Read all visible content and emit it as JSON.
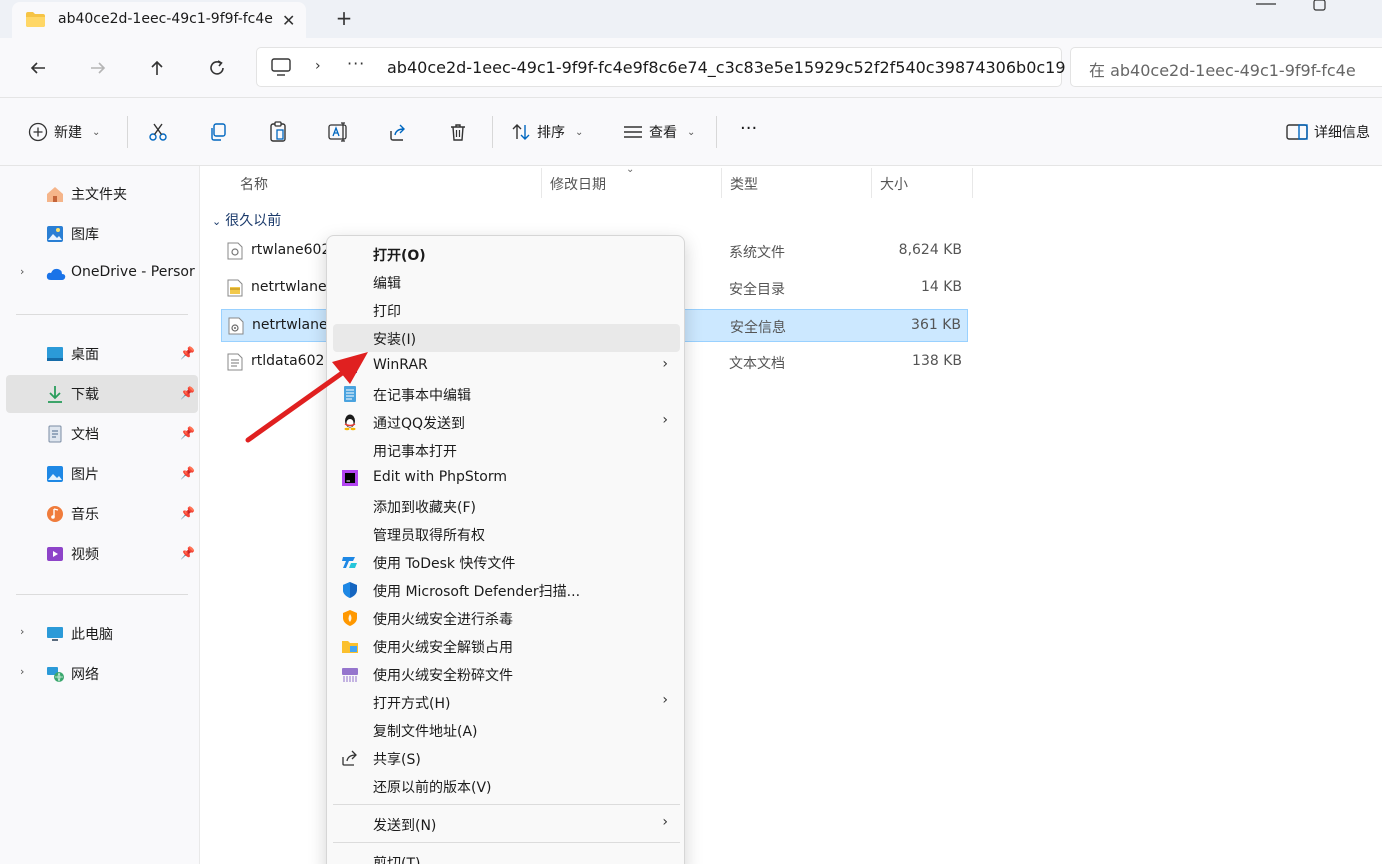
{
  "tab": {
    "title": "ab40ce2d-1eec-49c1-9f9f-fc4e",
    "close": "✕",
    "new_tab": "+"
  },
  "address": {
    "separator": "›",
    "more": "···",
    "path": "ab40ce2d-1eec-49c1-9f9f-fc4e9f8c6e74_c3c83e5e15929c52f2f540c39874306b0c19",
    "search_placeholder": "在 ab40ce2d-1eec-49c1-9f9f-fc4e"
  },
  "toolbar": {
    "new_label": "新建",
    "sort_label": "排序",
    "view_label": "查看",
    "more": "···",
    "details_label": "详细信息"
  },
  "sidebar": {
    "home": "主文件夹",
    "gallery": "图库",
    "onedrive": "OneDrive - Persor",
    "desktop": "桌面",
    "downloads": "下载",
    "documents": "文档",
    "pictures": "图片",
    "music": "音乐",
    "videos": "视频",
    "this_pc": "此电脑",
    "network": "网络"
  },
  "columns": {
    "name": "名称",
    "modified": "修改日期",
    "type": "类型",
    "size": "大小"
  },
  "group_label": "很久以前",
  "files": [
    {
      "name": "rtwlane602",
      "type": "系统文件",
      "size": "8,624 KB"
    },
    {
      "name": "netrtwlane",
      "type": "安全目录",
      "size": "14 KB"
    },
    {
      "name": "netrtwlane",
      "type": "安全信息",
      "size": "361 KB"
    },
    {
      "name": "rtldata602",
      "type": "文本文档",
      "size": "138 KB"
    }
  ],
  "context_menu": {
    "open": "打开(O)",
    "edit": "编辑",
    "print": "打印",
    "install": "安装(I)",
    "winrar": "WinRAR",
    "edit_notepad": "在记事本中编辑",
    "send_qq": "通过QQ发送到",
    "open_notepad": "用记事本打开",
    "phpstorm": "Edit with PhpStorm",
    "add_favorites": "添加到收藏夹(F)",
    "take_ownership": "管理员取得所有权",
    "todesk": "使用 ToDesk 快传文件",
    "defender": "使用 Microsoft Defender扫描...",
    "huorong_scan": "使用火绒安全进行杀毒",
    "huorong_unlock": "使用火绒安全解锁占用",
    "huorong_shred": "使用火绒安全粉碎文件",
    "open_with": "打开方式(H)",
    "copy_path": "复制文件地址(A)",
    "share": "共享(S)",
    "restore": "还原以前的版本(V)",
    "send_to": "发送到(N)",
    "cut": "剪切(T)"
  },
  "colors": {
    "accent": "#0067c0",
    "selection": "#cce8ff",
    "arrow": "#e02020"
  }
}
